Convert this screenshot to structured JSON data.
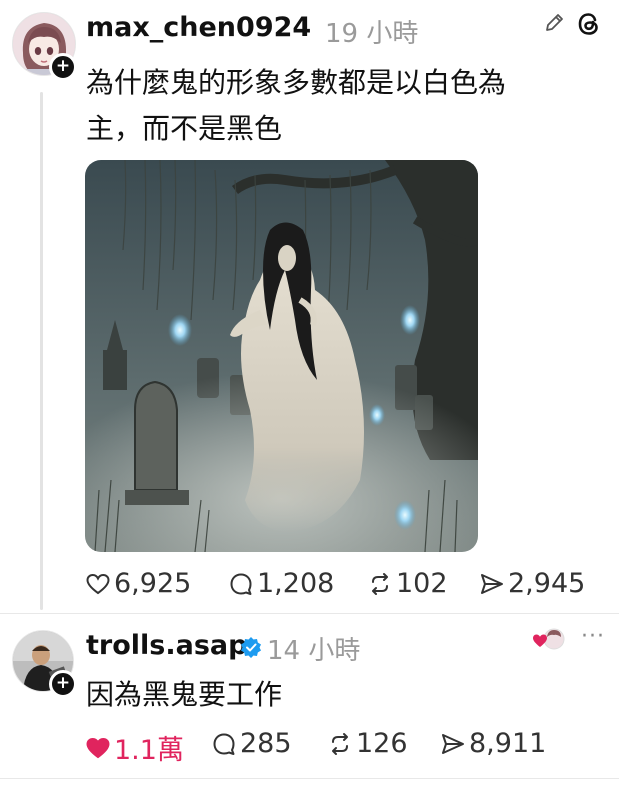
{
  "post": {
    "username": "max_chen0924",
    "time": "19 小時",
    "text_line1": "為什麼鬼的形象多數都是以白色為",
    "text_line2": "主，而不是黑色",
    "image_icon": "ghost-painting-image",
    "likes": "6,925",
    "comments": "1,208",
    "reposts": "102",
    "shares": "2,945"
  },
  "reply": {
    "username": "trolls.asap",
    "time": "14 小時",
    "text": "因為黑鬼要工作",
    "likes": "1.1萬",
    "comments": "285",
    "reposts": "126",
    "shares": "8,911"
  },
  "colors": {
    "like_red": "#e0245e",
    "verified_blue": "#1d9bf0"
  }
}
